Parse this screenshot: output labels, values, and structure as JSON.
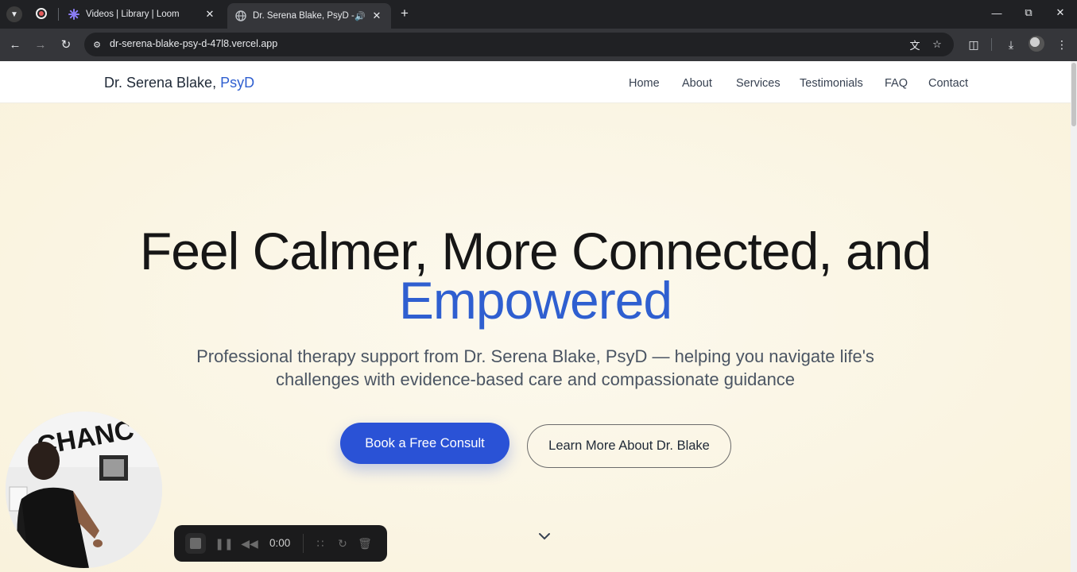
{
  "browser": {
    "tabs": [
      {
        "title": "Videos | Library | Loom",
        "active": false
      },
      {
        "title": "Dr. Serena Blake, PsyD - Lice",
        "active": true
      }
    ],
    "url": "dr-serena-blake-psy-d-47l8.vercel.app"
  },
  "site": {
    "brand_name": "Dr. Serena Blake,",
    "brand_accent": "PsyD",
    "nav": [
      "Home",
      "About",
      "Services",
      "Testimonials",
      "FAQ",
      "Contact"
    ],
    "accent_color": "#2f5fd0"
  },
  "hero": {
    "headline_line1": "Feel Calmer, More Connected, and",
    "headline_line2": "Empowered",
    "subtitle_line1": "Professional therapy support from Dr. Serena Blake, PsyD — helping you navigate life's",
    "subtitle_line2": "challenges with evidence-based care and compassionate guidance",
    "primary_cta": "Book a Free Consult",
    "secondary_cta": "Learn More About Dr. Blake"
  },
  "loom": {
    "timer": "0:00",
    "camera_wall_text": "CHANC"
  }
}
